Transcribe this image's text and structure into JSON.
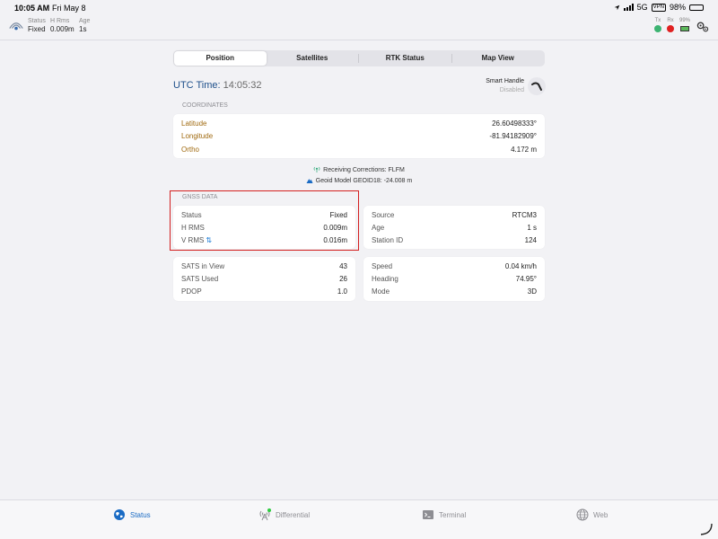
{
  "statusbar": {
    "time": "10:05 AM",
    "date": "Fri May 8",
    "network": "5G",
    "vpn": "VPN",
    "battery": "98%"
  },
  "header": {
    "status_label": "Status",
    "status_value": "Fixed",
    "hrms_label": "H Rms",
    "hrms_value": "0.009m",
    "age_label": "Age",
    "age_value": "1s",
    "tx_label": "Tx",
    "rx_label": "Rx",
    "battery_pct": "99%",
    "tx_color": "#3cb371",
    "rx_color": "#e02020"
  },
  "tabs": [
    {
      "label": "Position",
      "active": true
    },
    {
      "label": "Satellites",
      "active": false
    },
    {
      "label": "RTK Status",
      "active": false
    },
    {
      "label": "Map View",
      "active": false
    }
  ],
  "utc": {
    "label": "UTC Time:",
    "value": "14:05:32"
  },
  "smart_handle": {
    "label": "Smart Handle",
    "state": "Disabled"
  },
  "coordinates": {
    "title": "COORDINATES",
    "rows": [
      {
        "label": "Latitude",
        "value": "26.60498333°"
      },
      {
        "label": "Longitude",
        "value": "-81.94182909°"
      },
      {
        "label": "Ortho",
        "value": "4.172 m"
      }
    ]
  },
  "corrections": {
    "receiving": "Receiving Corrections: FLFM",
    "geoid": "Geoid Model GEOID18: -24.008 m"
  },
  "gnss": {
    "title": "GNSS DATA",
    "left": [
      {
        "label": "Status",
        "value": "Fixed"
      },
      {
        "label": "H RMS",
        "value": "0.009m"
      },
      {
        "label": "V RMS",
        "value": "0.016m"
      }
    ],
    "right": [
      {
        "label": "Source",
        "value": "RTCM3"
      },
      {
        "label": "Age",
        "value": "1 s"
      },
      {
        "label": "Station ID",
        "value": "124"
      }
    ]
  },
  "sats": [
    {
      "label": "SATS in View",
      "value": "43"
    },
    {
      "label": "SATS Used",
      "value": "26"
    },
    {
      "label": "PDOP",
      "value": "1.0"
    }
  ],
  "motion": [
    {
      "label": "Speed",
      "value": "0.04 km/h"
    },
    {
      "label": "Heading",
      "value": "74.95°"
    },
    {
      "label": "Mode",
      "value": "3D"
    }
  ],
  "tabbar": [
    {
      "label": "Status",
      "icon": "status-globe-icon",
      "active": true
    },
    {
      "label": "Differential",
      "icon": "antenna-icon",
      "active": false
    },
    {
      "label": "Terminal",
      "icon": "terminal-icon",
      "active": false
    },
    {
      "label": "Web",
      "icon": "globe-icon",
      "active": false
    }
  ],
  "accent": "#1a6bc4",
  "highlight_color": "#d42020"
}
